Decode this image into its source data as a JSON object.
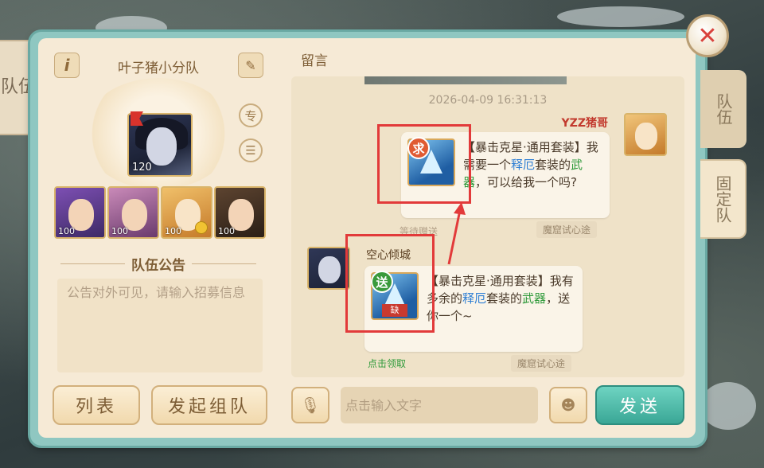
{
  "side_tabs": {
    "left": "队伍",
    "right_team": "队伍",
    "right_fixed": "固定队"
  },
  "team": {
    "name": "叶子猪小分队",
    "leader_level": "120",
    "members": [
      {
        "level": "100"
      },
      {
        "level": "100"
      },
      {
        "level": "100"
      },
      {
        "level": "100"
      }
    ],
    "notice_title": "队伍公告",
    "notice_placeholder": "公告对外可见，请输入招募信息"
  },
  "buttons": {
    "list": "列表",
    "create": "发起组队",
    "send": "发送"
  },
  "messages": {
    "title": "留言",
    "timestamp": "2026-04-09 16:31:13",
    "items": [
      {
        "sender": "YZZ猪哥",
        "tag": "求",
        "text_a": "【暴击克星·通用套装】我需要一个",
        "highlight_blue": "释厄",
        "text_b": "套装的",
        "highlight_green": "武器",
        "text_c": "，可以给我一个吗?",
        "status": "等待赠送",
        "source": "魔窟试心途"
      },
      {
        "sender": "空心倾城",
        "tag": "送",
        "item_badge": "缺",
        "text_a": "【暴击克星·通用套装】我有多余的",
        "highlight_blue": "释厄",
        "text_b": "套装的",
        "highlight_green": "武器",
        "text_c": "，送你一个~",
        "status": "点击领取",
        "source": "魔窟试心途"
      }
    ],
    "input_placeholder": "点击输入文字"
  },
  "icons": [
    "info-icon",
    "edit-icon",
    "specialist-icon",
    "menu-icon",
    "close-icon",
    "mic-icon",
    "emoji-icon"
  ],
  "colors": {
    "accent_teal": "#3aa796",
    "highlight_red": "#e23a3a",
    "text_brown": "#7d5d35"
  }
}
